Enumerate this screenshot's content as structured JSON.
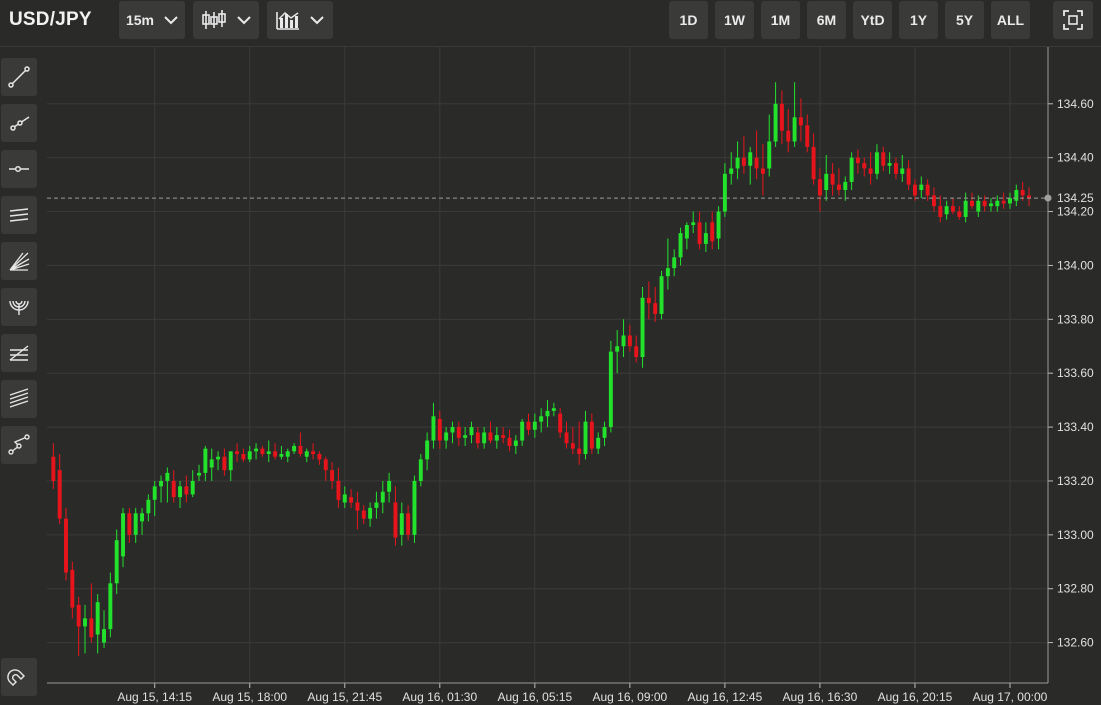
{
  "symbol": "USD/JPY",
  "toolbar": {
    "interval": "15m",
    "ranges": [
      "1D",
      "1W",
      "1M",
      "6M",
      "YtD",
      "1Y",
      "5Y",
      "ALL"
    ]
  },
  "sidebar_tools": [
    "trend-line-icon",
    "ray-icon",
    "horizontal-ray-icon",
    "parallel-channel-icon",
    "fib-fan-icon",
    "fib-arcs-icon",
    "fib-retracement-icon",
    "pitchfork-icon",
    "polyline-icon"
  ],
  "colors": {
    "up": "#22e22c",
    "down": "#e8141b",
    "background": "#2a2b29",
    "grid": "#3a3b39"
  },
  "chart_data": {
    "type": "candlestick",
    "title": "",
    "current_price": 134.25,
    "y_ticks": [
      "134.60",
      "134.40",
      "134.20",
      "134.00",
      "133.80",
      "133.60",
      "133.40",
      "133.20",
      "133.00",
      "132.80",
      "132.60"
    ],
    "x_ticks": [
      "Aug 15, 14:15",
      "Aug 15, 18:00",
      "Aug 15, 21:45",
      "Aug 16, 01:30",
      "Aug 16, 05:15",
      "Aug 16, 09:00",
      "Aug 16, 12:45",
      "Aug 16, 16:30",
      "Aug 16, 20:15",
      "Aug 17, 00:00"
    ],
    "ylim": [
      132.45,
      134.77
    ],
    "xlim_hours_from_first_tick": [
      -4.25,
      35.25
    ],
    "interval_minutes": 15,
    "grid": true,
    "candles": [
      [
        133.29,
        133.34,
        133.17,
        133.2
      ],
      [
        133.24,
        133.3,
        133.04,
        133.06
      ],
      [
        133.06,
        133.1,
        132.83,
        132.86
      ],
      [
        132.87,
        132.9,
        132.69,
        132.73
      ],
      [
        132.74,
        132.77,
        132.55,
        132.66
      ],
      [
        132.66,
        132.74,
        132.56,
        132.69
      ],
      [
        132.69,
        132.82,
        132.6,
        132.62
      ],
      [
        132.63,
        132.78,
        132.56,
        132.75
      ],
      [
        132.6,
        132.72,
        132.58,
        132.65
      ],
      [
        132.65,
        132.86,
        132.62,
        132.82
      ],
      [
        132.82,
        133.02,
        132.78,
        132.98
      ],
      [
        132.92,
        133.1,
        132.88,
        133.08
      ],
      [
        133.08,
        133.1,
        132.97,
        133.0
      ],
      [
        133.0,
        133.1,
        132.97,
        133.08
      ],
      [
        133.05,
        133.1,
        133.0,
        133.08
      ],
      [
        133.08,
        133.15,
        133.05,
        133.13
      ],
      [
        133.13,
        133.2,
        133.07,
        133.18
      ],
      [
        133.18,
        133.22,
        133.12,
        133.2
      ],
      [
        133.2,
        133.25,
        133.12,
        133.23
      ],
      [
        133.2,
        133.24,
        133.12,
        133.14
      ],
      [
        133.14,
        133.2,
        133.1,
        133.18
      ],
      [
        133.18,
        133.22,
        133.12,
        133.15
      ],
      [
        133.15,
        133.24,
        133.14,
        133.2
      ],
      [
        133.22,
        133.26,
        133.2,
        133.23
      ],
      [
        133.23,
        133.33,
        133.2,
        133.32
      ],
      [
        133.25,
        133.32,
        133.2,
        133.28
      ],
      [
        133.28,
        133.31,
        133.24,
        133.29
      ],
      [
        133.29,
        133.32,
        133.22,
        133.24
      ],
      [
        133.24,
        133.3,
        133.2,
        133.31
      ],
      [
        133.31,
        133.34,
        133.27,
        133.3
      ],
      [
        133.3,
        133.32,
        133.27,
        133.28
      ],
      [
        133.28,
        133.33,
        133.27,
        133.31
      ],
      [
        133.31,
        133.34,
        133.28,
        133.32
      ],
      [
        133.32,
        133.33,
        133.29,
        133.3
      ],
      [
        133.3,
        133.35,
        133.27,
        133.31
      ],
      [
        133.31,
        133.34,
        133.28,
        133.29
      ],
      [
        133.29,
        133.33,
        133.28,
        133.3
      ],
      [
        133.29,
        133.32,
        133.27,
        133.31
      ],
      [
        133.31,
        133.34,
        133.3,
        133.33
      ],
      [
        133.33,
        133.38,
        133.29,
        133.3
      ],
      [
        133.29,
        133.32,
        133.27,
        133.31
      ],
      [
        133.31,
        133.34,
        133.28,
        133.3
      ],
      [
        133.3,
        133.31,
        133.26,
        133.28
      ],
      [
        133.28,
        133.29,
        133.2,
        133.24
      ],
      [
        133.24,
        133.27,
        133.17,
        133.2
      ],
      [
        133.2,
        133.25,
        133.1,
        133.13
      ],
      [
        133.12,
        133.18,
        133.1,
        133.15
      ],
      [
        133.14,
        133.17,
        133.1,
        133.12
      ],
      [
        133.12,
        133.16,
        133.02,
        133.09
      ],
      [
        133.09,
        133.11,
        133.04,
        133.06
      ],
      [
        133.06,
        133.12,
        133.03,
        133.1
      ],
      [
        133.1,
        133.16,
        133.06,
        133.12
      ],
      [
        133.12,
        133.2,
        133.08,
        133.16
      ],
      [
        133.16,
        133.23,
        133.12,
        133.2
      ],
      [
        133.12,
        133.18,
        132.96,
        132.99
      ],
      [
        133.0,
        133.12,
        132.96,
        133.08
      ],
      [
        133.08,
        133.11,
        132.98,
        133.0
      ],
      [
        133.0,
        133.22,
        132.97,
        133.2
      ],
      [
        133.2,
        133.3,
        133.18,
        133.28
      ],
      [
        133.28,
        133.38,
        133.24,
        133.35
      ],
      [
        133.35,
        133.49,
        133.32,
        133.44
      ],
      [
        133.43,
        133.46,
        133.32,
        133.35
      ],
      [
        133.35,
        133.4,
        133.32,
        133.38
      ],
      [
        133.38,
        133.42,
        133.34,
        133.4
      ],
      [
        133.4,
        133.42,
        133.33,
        133.36
      ],
      [
        133.36,
        133.4,
        133.33,
        133.37
      ],
      [
        133.37,
        133.42,
        133.34,
        133.4
      ],
      [
        133.38,
        133.4,
        133.32,
        133.34
      ],
      [
        133.34,
        133.4,
        133.32,
        133.38
      ],
      [
        133.38,
        133.42,
        133.34,
        133.35
      ],
      [
        133.35,
        133.4,
        133.32,
        133.37
      ],
      [
        133.37,
        133.4,
        133.34,
        133.36
      ],
      [
        133.36,
        133.39,
        133.31,
        133.33
      ],
      [
        133.33,
        133.37,
        133.3,
        133.35
      ],
      [
        133.35,
        133.43,
        133.33,
        133.42
      ],
      [
        133.42,
        133.45,
        133.37,
        133.39
      ],
      [
        133.39,
        133.45,
        133.36,
        133.42
      ],
      [
        133.42,
        133.47,
        133.38,
        133.44
      ],
      [
        133.44,
        133.5,
        133.4,
        133.46
      ],
      [
        133.46,
        133.49,
        133.44,
        133.47
      ],
      [
        133.45,
        133.47,
        133.36,
        133.38
      ],
      [
        133.38,
        133.42,
        133.32,
        133.34
      ],
      [
        133.34,
        133.4,
        133.3,
        133.32
      ],
      [
        133.32,
        133.42,
        133.26,
        133.3
      ],
      [
        133.3,
        133.46,
        133.28,
        133.42
      ],
      [
        133.42,
        133.45,
        133.3,
        133.32
      ],
      [
        133.32,
        133.38,
        133.3,
        133.36
      ],
      [
        133.36,
        133.42,
        133.33,
        133.4
      ],
      [
        133.4,
        133.72,
        133.38,
        133.68
      ],
      [
        133.68,
        133.76,
        133.6,
        133.7
      ],
      [
        133.7,
        133.8,
        133.66,
        133.74
      ],
      [
        133.74,
        133.78,
        133.68,
        133.7
      ],
      [
        133.7,
        133.74,
        133.64,
        133.66
      ],
      [
        133.66,
        133.92,
        133.62,
        133.88
      ],
      [
        133.88,
        133.94,
        133.8,
        133.86
      ],
      [
        133.86,
        133.92,
        133.79,
        133.82
      ],
      [
        133.82,
        133.98,
        133.8,
        133.96
      ],
      [
        133.96,
        134.1,
        133.91,
        133.99
      ],
      [
        133.99,
        134.06,
        133.96,
        134.03
      ],
      [
        134.03,
        134.14,
        134.0,
        134.12
      ],
      [
        134.1,
        134.16,
        134.06,
        134.15
      ],
      [
        134.15,
        134.2,
        134.12,
        134.16
      ],
      [
        134.16,
        134.2,
        134.06,
        134.08
      ],
      [
        134.08,
        134.16,
        134.05,
        134.12
      ],
      [
        134.16,
        134.2,
        134.06,
        134.09
      ],
      [
        134.1,
        134.22,
        134.06,
        134.2
      ],
      [
        134.2,
        134.38,
        134.18,
        134.34
      ],
      [
        134.34,
        134.42,
        134.3,
        134.36
      ],
      [
        134.36,
        134.46,
        134.32,
        134.4
      ],
      [
        134.4,
        134.48,
        134.34,
        134.37
      ],
      [
        134.37,
        134.44,
        134.3,
        134.42
      ],
      [
        134.4,
        134.5,
        134.32,
        134.36
      ],
      [
        134.36,
        134.45,
        134.26,
        134.34
      ],
      [
        134.36,
        134.56,
        134.33,
        134.46
      ],
      [
        134.46,
        134.68,
        134.44,
        134.6
      ],
      [
        134.6,
        134.65,
        134.45,
        134.5
      ],
      [
        134.5,
        134.58,
        134.42,
        134.46
      ],
      [
        134.46,
        134.68,
        134.44,
        134.55
      ],
      [
        134.55,
        134.62,
        134.46,
        134.52
      ],
      [
        134.52,
        134.56,
        134.42,
        134.44
      ],
      [
        134.44,
        134.49,
        134.3,
        134.32
      ],
      [
        134.32,
        134.36,
        134.2,
        134.26
      ],
      [
        134.28,
        134.41,
        134.24,
        134.34
      ],
      [
        134.34,
        134.38,
        134.26,
        134.3
      ],
      [
        134.3,
        134.36,
        134.26,
        134.28
      ],
      [
        134.28,
        134.33,
        134.24,
        134.31
      ],
      [
        134.31,
        134.42,
        134.28,
        134.4
      ],
      [
        134.4,
        134.43,
        134.34,
        134.38
      ],
      [
        134.38,
        134.4,
        134.33,
        134.36
      ],
      [
        134.36,
        134.42,
        134.3,
        134.34
      ],
      [
        134.34,
        134.45,
        134.32,
        134.42
      ],
      [
        134.42,
        134.44,
        134.35,
        134.37
      ],
      [
        134.37,
        134.42,
        134.34,
        134.38
      ],
      [
        134.38,
        134.4,
        134.32,
        134.34
      ],
      [
        134.34,
        134.41,
        134.31,
        134.36
      ],
      [
        134.36,
        134.39,
        134.28,
        134.3
      ],
      [
        134.3,
        134.32,
        134.24,
        134.26
      ],
      [
        134.28,
        134.33,
        134.25,
        134.3
      ],
      [
        134.3,
        134.32,
        134.24,
        134.26
      ],
      [
        134.26,
        134.29,
        134.2,
        134.22
      ],
      [
        134.22,
        134.26,
        134.16,
        134.18
      ],
      [
        134.19,
        134.24,
        134.17,
        134.22
      ],
      [
        134.22,
        134.25,
        134.19,
        134.2
      ],
      [
        134.2,
        134.22,
        134.17,
        134.18
      ],
      [
        134.18,
        134.27,
        134.16,
        134.24
      ],
      [
        134.24,
        134.27,
        134.21,
        134.22
      ],
      [
        134.2,
        134.26,
        134.18,
        134.24
      ],
      [
        134.24,
        134.26,
        134.2,
        134.22
      ],
      [
        134.22,
        134.25,
        134.2,
        134.23
      ],
      [
        134.22,
        134.26,
        134.2,
        134.24
      ],
      [
        134.24,
        134.27,
        134.21,
        134.23
      ],
      [
        134.23,
        134.27,
        134.21,
        134.25
      ],
      [
        134.24,
        134.3,
        134.22,
        134.28
      ],
      [
        134.28,
        134.31,
        134.24,
        134.26
      ],
      [
        134.26,
        134.29,
        134.22,
        134.25
      ]
    ]
  }
}
